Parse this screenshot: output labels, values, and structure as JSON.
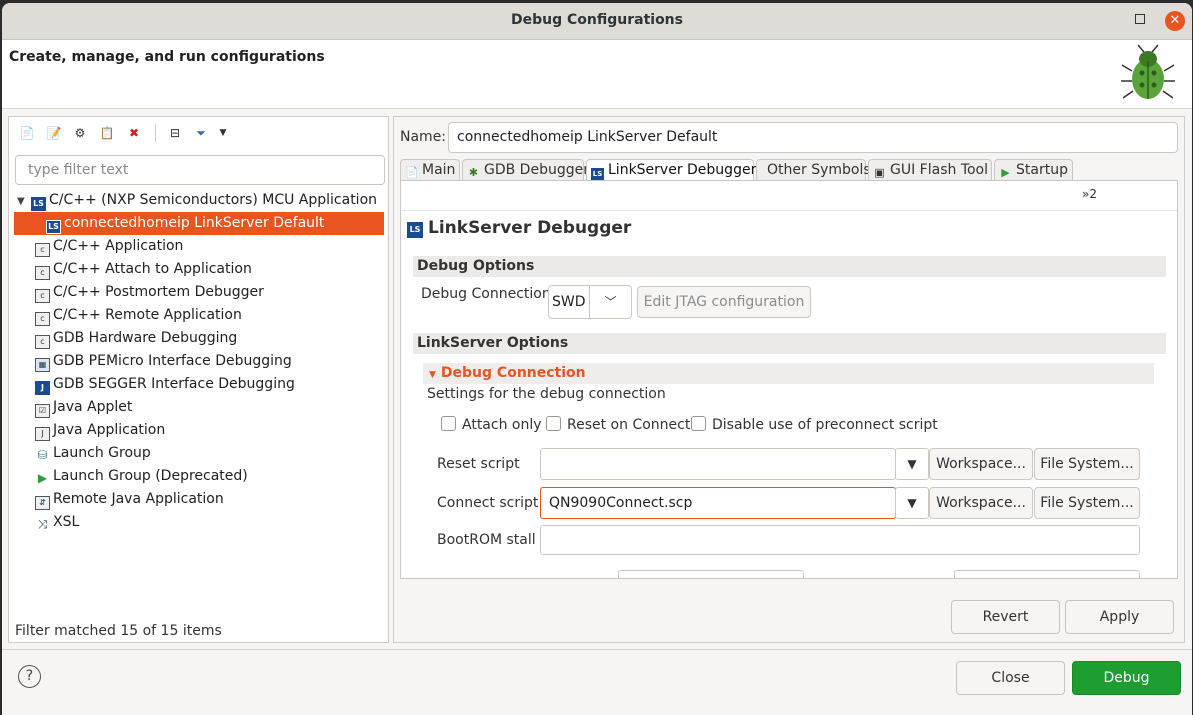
{
  "window": {
    "title": "Debug Configurations"
  },
  "banner": {
    "message": "Create, manage, and run configurations"
  },
  "left": {
    "filter_placeholder": "type filter text",
    "tree": [
      {
        "label": "C/C++ (NXP Semiconductors) MCU Application",
        "icon": "ls-icon",
        "expanded": true
      },
      {
        "label": "connectedhomeip LinkServer Default",
        "icon": "ls-icon",
        "selected": true
      },
      {
        "label": "C/C++ Application",
        "icon": "c-app-icon"
      },
      {
        "label": "C/C++ Attach to Application",
        "icon": "c-app-icon"
      },
      {
        "label": "C/C++ Postmortem Debugger",
        "icon": "c-app-icon"
      },
      {
        "label": "C/C++ Remote Application",
        "icon": "c-app-icon"
      },
      {
        "label": "GDB Hardware Debugging",
        "icon": "c-app-icon"
      },
      {
        "label": "GDB PEMicro Interface Debugging",
        "icon": "pemicro-icon"
      },
      {
        "label": "GDB SEGGER Interface Debugging",
        "icon": "segger-icon"
      },
      {
        "label": "Java Applet",
        "icon": "java-applet-icon"
      },
      {
        "label": "Java Application",
        "icon": "java-app-icon"
      },
      {
        "label": "Launch Group",
        "icon": "launch-group-icon"
      },
      {
        "label": "Launch Group (Deprecated)",
        "icon": "play-icon"
      },
      {
        "label": "Remote Java Application",
        "icon": "remote-java-icon"
      },
      {
        "label": "XSL",
        "icon": "xsl-icon"
      }
    ],
    "status": "Filter matched 15 of 15 items"
  },
  "right": {
    "name_label": "Name:",
    "name_value": "connectedhomeip LinkServer Default",
    "tabs": [
      {
        "label": "Main",
        "icon": "document-icon"
      },
      {
        "label": "GDB Debugger",
        "icon": "bug-icon"
      },
      {
        "label": "LinkServer Debugger",
        "icon": "ls-icon",
        "active": true
      },
      {
        "label": "Other Symbols",
        "icon": ""
      },
      {
        "label": "GUI Flash Tool",
        "icon": "chip-icon"
      },
      {
        "label": "Startup",
        "icon": "play-icon"
      }
    ],
    "overflow_indicator": "»2",
    "panel_title": "LinkServer Debugger",
    "debug_options": {
      "section": "Debug Options",
      "connection_label": "Debug Connection",
      "connection_value": "SWD",
      "edit_jtag": "Edit JTAG configuration"
    },
    "linkserver_options": {
      "section": "LinkServer Options",
      "subsection": "Debug Connection",
      "subsection_desc": "Settings for the debug connection",
      "checkboxes": [
        "Attach only",
        "Reset on Connect",
        "Disable use of preconnect script"
      ],
      "reset_script_label": "Reset script",
      "reset_script_value": "",
      "connect_script_label": "Connect script",
      "connect_script_value": "QN9090Connect.scp",
      "bootrom_label": "BootROM stall",
      "bootrom_value": "",
      "workspace_btn": "Workspace...",
      "filesystem_btn": "File System..."
    },
    "revert": "Revert",
    "apply": "Apply"
  },
  "footer": {
    "close": "Close",
    "debug": "Debug"
  },
  "colors": {
    "accent": "#e95420",
    "primary_button": "#1e9e30",
    "ls_blue": "#1b4c92"
  }
}
